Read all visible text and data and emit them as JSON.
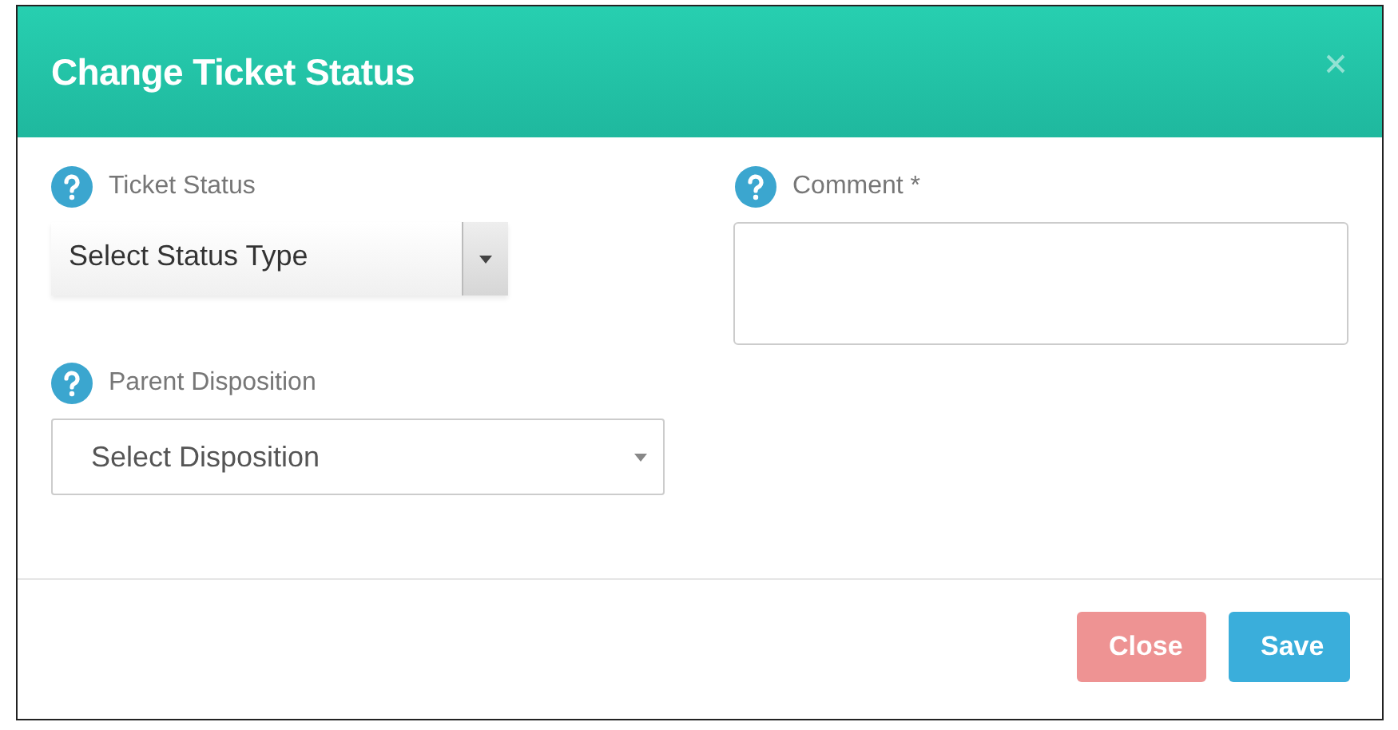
{
  "dialog": {
    "title": "Change Ticket Status"
  },
  "fields": [
    {
      "kind": "button-select",
      "label": "Ticket Status",
      "value": "Select Status Type"
    },
    {
      "kind": "select",
      "label": "Parent Disposition",
      "value": "Select Disposition"
    },
    {
      "kind": "textarea",
      "label": "Comment *"
    }
  ],
  "buttons": [
    {
      "label": "Close",
      "kind": "danger",
      "disabled": true
    },
    {
      "label": "Save",
      "kind": "primary",
      "disabled": false
    }
  ]
}
